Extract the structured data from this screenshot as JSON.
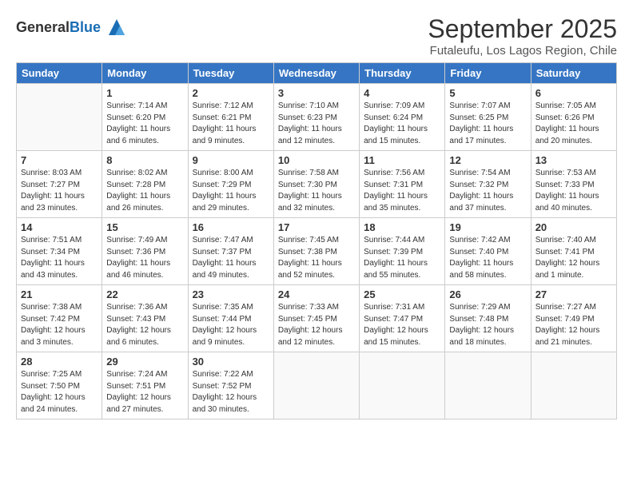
{
  "logo": {
    "general": "General",
    "blue": "Blue"
  },
  "header": {
    "month_title": "September 2025",
    "subtitle": "Futaleufu, Los Lagos Region, Chile"
  },
  "days_of_week": [
    "Sunday",
    "Monday",
    "Tuesday",
    "Wednesday",
    "Thursday",
    "Friday",
    "Saturday"
  ],
  "weeks": [
    [
      {
        "day": "",
        "info": ""
      },
      {
        "day": "1",
        "info": "Sunrise: 7:14 AM\nSunset: 6:20 PM\nDaylight: 11 hours\nand 6 minutes."
      },
      {
        "day": "2",
        "info": "Sunrise: 7:12 AM\nSunset: 6:21 PM\nDaylight: 11 hours\nand 9 minutes."
      },
      {
        "day": "3",
        "info": "Sunrise: 7:10 AM\nSunset: 6:23 PM\nDaylight: 11 hours\nand 12 minutes."
      },
      {
        "day": "4",
        "info": "Sunrise: 7:09 AM\nSunset: 6:24 PM\nDaylight: 11 hours\nand 15 minutes."
      },
      {
        "day": "5",
        "info": "Sunrise: 7:07 AM\nSunset: 6:25 PM\nDaylight: 11 hours\nand 17 minutes."
      },
      {
        "day": "6",
        "info": "Sunrise: 7:05 AM\nSunset: 6:26 PM\nDaylight: 11 hours\nand 20 minutes."
      }
    ],
    [
      {
        "day": "7",
        "info": "Sunrise: 8:03 AM\nSunset: 7:27 PM\nDaylight: 11 hours\nand 23 minutes."
      },
      {
        "day": "8",
        "info": "Sunrise: 8:02 AM\nSunset: 7:28 PM\nDaylight: 11 hours\nand 26 minutes."
      },
      {
        "day": "9",
        "info": "Sunrise: 8:00 AM\nSunset: 7:29 PM\nDaylight: 11 hours\nand 29 minutes."
      },
      {
        "day": "10",
        "info": "Sunrise: 7:58 AM\nSunset: 7:30 PM\nDaylight: 11 hours\nand 32 minutes."
      },
      {
        "day": "11",
        "info": "Sunrise: 7:56 AM\nSunset: 7:31 PM\nDaylight: 11 hours\nand 35 minutes."
      },
      {
        "day": "12",
        "info": "Sunrise: 7:54 AM\nSunset: 7:32 PM\nDaylight: 11 hours\nand 37 minutes."
      },
      {
        "day": "13",
        "info": "Sunrise: 7:53 AM\nSunset: 7:33 PM\nDaylight: 11 hours\nand 40 minutes."
      }
    ],
    [
      {
        "day": "14",
        "info": "Sunrise: 7:51 AM\nSunset: 7:34 PM\nDaylight: 11 hours\nand 43 minutes."
      },
      {
        "day": "15",
        "info": "Sunrise: 7:49 AM\nSunset: 7:36 PM\nDaylight: 11 hours\nand 46 minutes."
      },
      {
        "day": "16",
        "info": "Sunrise: 7:47 AM\nSunset: 7:37 PM\nDaylight: 11 hours\nand 49 minutes."
      },
      {
        "day": "17",
        "info": "Sunrise: 7:45 AM\nSunset: 7:38 PM\nDaylight: 11 hours\nand 52 minutes."
      },
      {
        "day": "18",
        "info": "Sunrise: 7:44 AM\nSunset: 7:39 PM\nDaylight: 11 hours\nand 55 minutes."
      },
      {
        "day": "19",
        "info": "Sunrise: 7:42 AM\nSunset: 7:40 PM\nDaylight: 11 hours\nand 58 minutes."
      },
      {
        "day": "20",
        "info": "Sunrise: 7:40 AM\nSunset: 7:41 PM\nDaylight: 12 hours\nand 1 minute."
      }
    ],
    [
      {
        "day": "21",
        "info": "Sunrise: 7:38 AM\nSunset: 7:42 PM\nDaylight: 12 hours\nand 3 minutes."
      },
      {
        "day": "22",
        "info": "Sunrise: 7:36 AM\nSunset: 7:43 PM\nDaylight: 12 hours\nand 6 minutes."
      },
      {
        "day": "23",
        "info": "Sunrise: 7:35 AM\nSunset: 7:44 PM\nDaylight: 12 hours\nand 9 minutes."
      },
      {
        "day": "24",
        "info": "Sunrise: 7:33 AM\nSunset: 7:45 PM\nDaylight: 12 hours\nand 12 minutes."
      },
      {
        "day": "25",
        "info": "Sunrise: 7:31 AM\nSunset: 7:47 PM\nDaylight: 12 hours\nand 15 minutes."
      },
      {
        "day": "26",
        "info": "Sunrise: 7:29 AM\nSunset: 7:48 PM\nDaylight: 12 hours\nand 18 minutes."
      },
      {
        "day": "27",
        "info": "Sunrise: 7:27 AM\nSunset: 7:49 PM\nDaylight: 12 hours\nand 21 minutes."
      }
    ],
    [
      {
        "day": "28",
        "info": "Sunrise: 7:25 AM\nSunset: 7:50 PM\nDaylight: 12 hours\nand 24 minutes."
      },
      {
        "day": "29",
        "info": "Sunrise: 7:24 AM\nSunset: 7:51 PM\nDaylight: 12 hours\nand 27 minutes."
      },
      {
        "day": "30",
        "info": "Sunrise: 7:22 AM\nSunset: 7:52 PM\nDaylight: 12 hours\nand 30 minutes."
      },
      {
        "day": "",
        "info": ""
      },
      {
        "day": "",
        "info": ""
      },
      {
        "day": "",
        "info": ""
      },
      {
        "day": "",
        "info": ""
      }
    ]
  ]
}
